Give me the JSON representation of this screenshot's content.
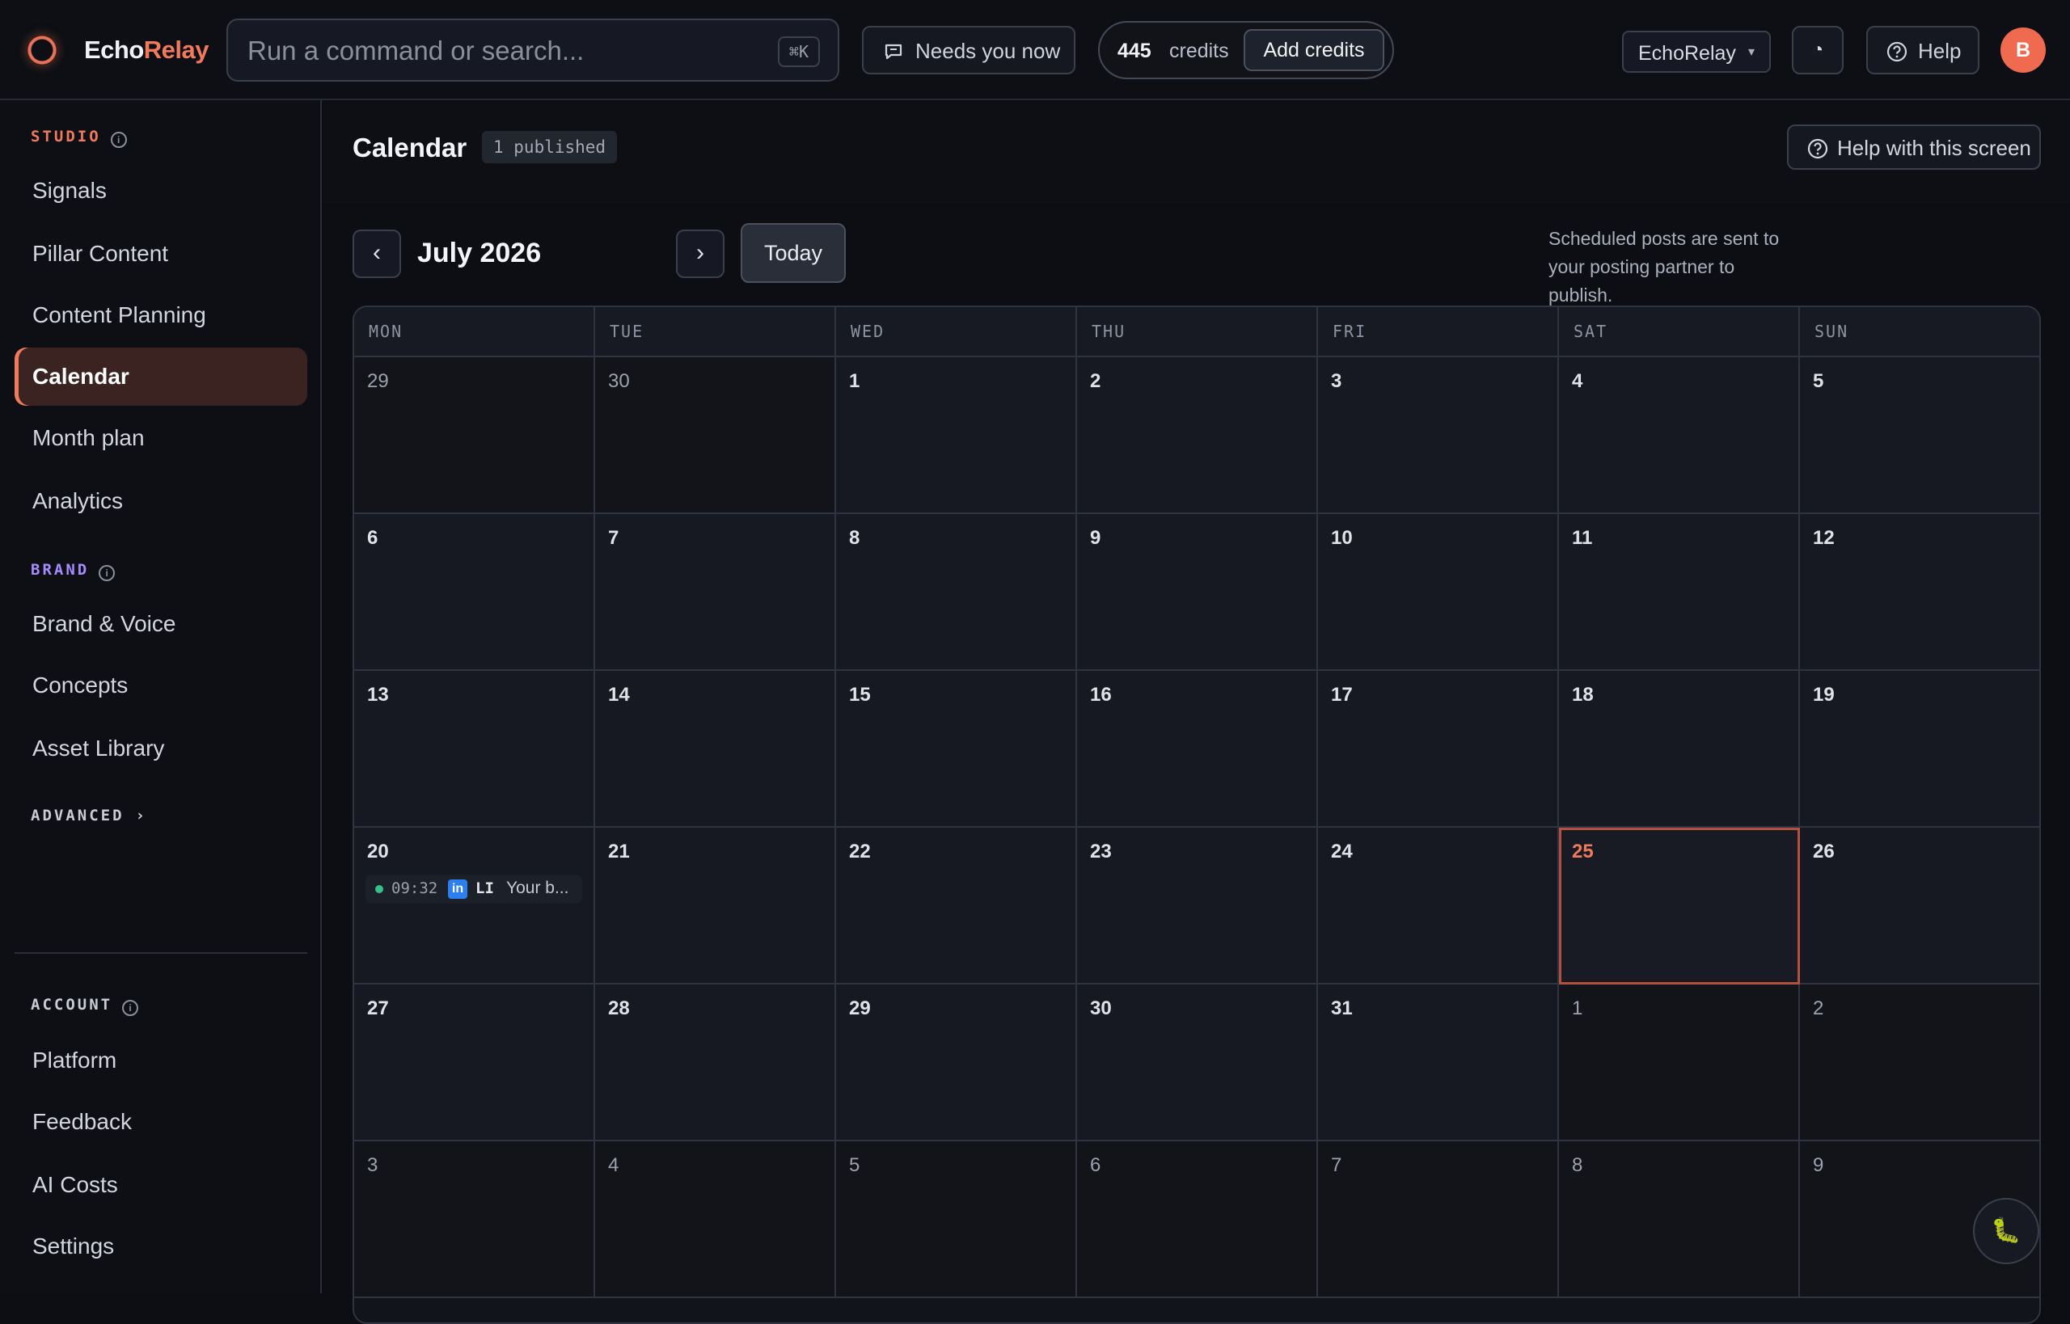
{
  "app": {
    "brand_a": "Echo",
    "brand_b": "Relay",
    "accent": "#f07a5c"
  },
  "topbar": {
    "search_placeholder": "Run a command or search...",
    "search_shortcut": "⌘K",
    "needs_label": "Needs you now",
    "credits_value": "445",
    "credits_label": "credits",
    "add_credits_label": "Add credits",
    "workspace_label": "EchoRelay",
    "theme_icon": "◔",
    "help_label": "Help",
    "avatar_initial": "B"
  },
  "sidebar": {
    "studio_label": "STUDIO",
    "studio_items": [
      "Signals",
      "Pillar Content",
      "Content Planning",
      "Calendar",
      "Month plan",
      "Analytics"
    ],
    "brand_label": "BRAND",
    "brand_items": [
      "Brand & Voice",
      "Concepts",
      "Asset Library"
    ],
    "advanced_label": "ADVANCED",
    "account_label": "ACCOUNT",
    "account_items": [
      "Platform",
      "Feedback",
      "AI Costs",
      "Settings"
    ]
  },
  "header": {
    "title": "Calendar",
    "badge": "1 published",
    "help_screen_label": "Help with this screen"
  },
  "calendar": {
    "prev_label": "‹",
    "next_label": "›",
    "month_label": "July 2026",
    "today_label": "Today",
    "note": "Scheduled posts are sent to your posting partner to publish.",
    "days_of_week": [
      "MON",
      "TUE",
      "WED",
      "THU",
      "FRI",
      "SAT",
      "SUN"
    ],
    "today_date": "25",
    "weeks": [
      [
        {
          "d": "29",
          "out": true
        },
        {
          "d": "30",
          "out": true
        },
        {
          "d": "1"
        },
        {
          "d": "2"
        },
        {
          "d": "3"
        },
        {
          "d": "4"
        },
        {
          "d": "5"
        }
      ],
      [
        {
          "d": "6"
        },
        {
          "d": "7"
        },
        {
          "d": "8"
        },
        {
          "d": "9"
        },
        {
          "d": "10"
        },
        {
          "d": "11"
        },
        {
          "d": "12"
        }
      ],
      [
        {
          "d": "13"
        },
        {
          "d": "14"
        },
        {
          "d": "15"
        },
        {
          "d": "16"
        },
        {
          "d": "17"
        },
        {
          "d": "18"
        },
        {
          "d": "19"
        }
      ],
      [
        {
          "d": "20",
          "event": {
            "time": "09:32",
            "icon": "linkedin-icon",
            "icon_text": "in",
            "platform": "LI",
            "title": "Your b...",
            "status_color": "#35c28a"
          }
        },
        {
          "d": "21"
        },
        {
          "d": "22"
        },
        {
          "d": "23"
        },
        {
          "d": "24"
        },
        {
          "d": "25",
          "today": true
        },
        {
          "d": "26"
        }
      ],
      [
        {
          "d": "27"
        },
        {
          "d": "28"
        },
        {
          "d": "29"
        },
        {
          "d": "30"
        },
        {
          "d": "31"
        },
        {
          "d": "1",
          "out": true
        },
        {
          "d": "2",
          "out": true
        }
      ],
      [
        {
          "d": "3",
          "out": true
        },
        {
          "d": "4",
          "out": true
        },
        {
          "d": "5",
          "out": true
        },
        {
          "d": "6",
          "out": true
        },
        {
          "d": "7",
          "out": true
        },
        {
          "d": "8",
          "out": true
        },
        {
          "d": "9",
          "out": true
        }
      ]
    ]
  },
  "fab": {
    "icon": "bug-icon",
    "glyph": "🐛"
  }
}
